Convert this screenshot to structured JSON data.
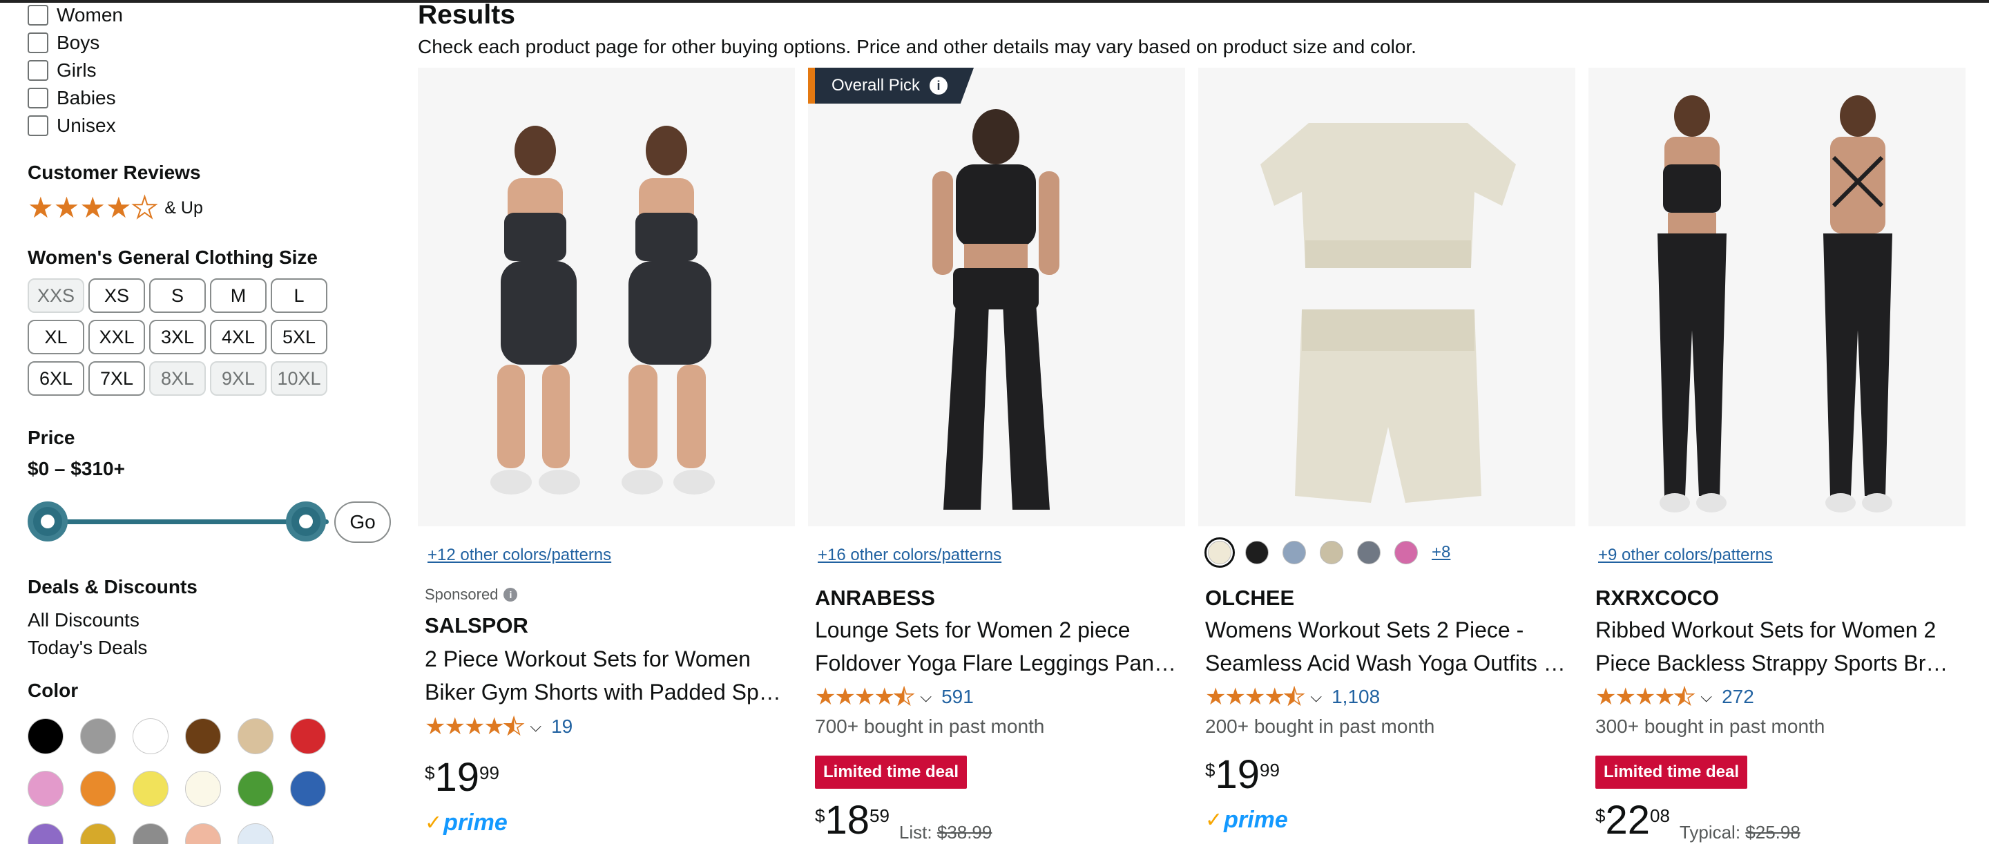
{
  "sidebar": {
    "gender": [
      {
        "label": "Women"
      },
      {
        "label": "Boys"
      },
      {
        "label": "Girls"
      },
      {
        "label": "Babies"
      },
      {
        "label": "Unisex"
      }
    ],
    "reviews_title": "Customer Reviews",
    "reviews_suffix": "& Up",
    "reviews_stars": 4,
    "size_title": "Women's General Clothing Size",
    "sizes": [
      {
        "label": "XXS",
        "enabled": false
      },
      {
        "label": "XS",
        "enabled": true
      },
      {
        "label": "S",
        "enabled": true
      },
      {
        "label": "M",
        "enabled": true
      },
      {
        "label": "L",
        "enabled": true
      },
      {
        "label": "XL",
        "enabled": true
      },
      {
        "label": "XXL",
        "enabled": true
      },
      {
        "label": "3XL",
        "enabled": true
      },
      {
        "label": "4XL",
        "enabled": true
      },
      {
        "label": "5XL",
        "enabled": true
      },
      {
        "label": "6XL",
        "enabled": true
      },
      {
        "label": "7XL",
        "enabled": true
      },
      {
        "label": "8XL",
        "enabled": false
      },
      {
        "label": "9XL",
        "enabled": false
      },
      {
        "label": "10XL",
        "enabled": false
      }
    ],
    "price_title": "Price",
    "price_range": "$0 – $310+",
    "go_label": "Go",
    "deals_title": "Deals & Discounts",
    "deals": [
      "All Discounts",
      "Today's Deals"
    ],
    "color_title": "Color",
    "colors": [
      "#000000",
      "#9a9a9a",
      "#ffffff",
      "#6b3e15",
      "#d9c19c",
      "#d4282d",
      "#e39acb",
      "#e98a2a",
      "#f1e25a",
      "#fbf8e8",
      "#4a9a35",
      "#2f63b0",
      "#8d6ac6",
      "#d6a92a",
      "#8c8c8c",
      "#f0b8a0",
      "#dfeaf5"
    ]
  },
  "results": {
    "title": "Results",
    "subtitle": "Check each product page for other buying options. Price and other details may vary based on product size and color."
  },
  "products": [
    {
      "colors_link": "+12 other colors/patterns",
      "sponsored": "Sponsored",
      "brand": "SALSPOR",
      "title_l1": "2 Piece Workout Sets for Women",
      "title_l2": "Biker Gym Shorts with Padded Sports Bra",
      "rating": 4.5,
      "reviews": "19",
      "price_whole": "19",
      "price_frac": "99",
      "prime": "prime"
    },
    {
      "badge": "Overall Pick",
      "colors_link": "+16 other colors/patterns",
      "brand": "ANRABESS",
      "title_l1": "Lounge Sets for Women 2 piece",
      "title_l2": "Foldover Yoga Flare Leggings Pants Set",
      "rating": 4.5,
      "reviews": "591",
      "bought": "700+ bought in past month",
      "deal": "Limited time deal",
      "price_whole": "18",
      "price_frac": "59",
      "list_label": "List:",
      "list_price": "$38.99"
    },
    {
      "color_dots": [
        "#efe9d6",
        "#1e1e1e",
        "#8ea3bd",
        "#c9bfa4",
        "#707884",
        "#d36aa8"
      ],
      "color_more": "+8",
      "brand": "OLCHEE",
      "title_l1": "Womens Workout Sets 2 Piece -",
      "title_l2": "Seamless Acid Wash Yoga Outfits Set",
      "rating": 4.5,
      "reviews": "1,108",
      "bought": "200+ bought in past month",
      "price_whole": "19",
      "price_frac": "99",
      "prime": "prime"
    },
    {
      "colors_link": "+9 other colors/patterns",
      "brand": "RXRXCOCO",
      "title_l1": "Ribbed Workout Sets for Women 2",
      "title_l2": "Piece Backless Strappy Sports Bra Set",
      "rating": 4.5,
      "reviews": "272",
      "bought": "300+ bought in past month",
      "deal": "Limited time deal",
      "price_whole": "22",
      "price_frac": "08",
      "list_label": "Typical:",
      "list_price": "$25.98"
    }
  ]
}
